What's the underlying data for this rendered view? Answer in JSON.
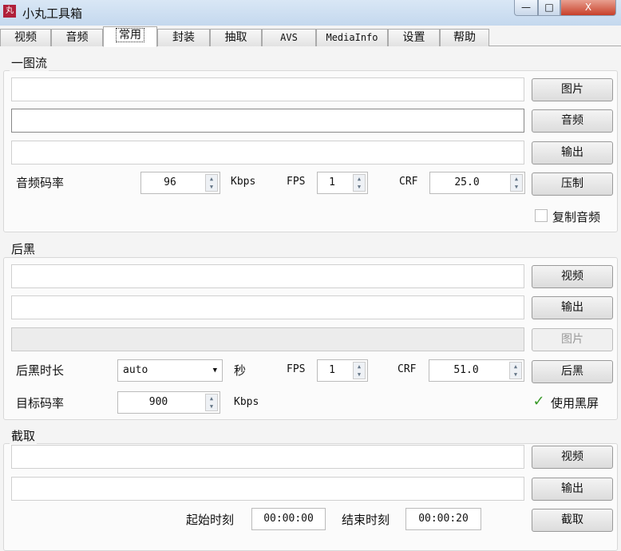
{
  "window": {
    "title": "小丸工具箱",
    "icon_text": "丸",
    "min": "—",
    "max": "□",
    "close": "X"
  },
  "tabs": [
    "视频",
    "音频",
    "常用",
    "封装",
    "抽取",
    "AVS",
    "MediaInfo",
    "设置",
    "帮助"
  ],
  "one_image": {
    "title": "一图流",
    "btn_image": "图片",
    "btn_audio": "音频",
    "btn_output": "输出",
    "btn_encode": "压制",
    "audio_bitrate_label": "音频码率",
    "audio_bitrate": "96",
    "kbps": "Kbps",
    "fps_label": "FPS",
    "fps": "1",
    "crf_label": "CRF",
    "crf": "25.0",
    "copy_audio_label": "复制音频",
    "copy_audio": false
  },
  "black_tail": {
    "title": "后黑",
    "btn_video": "视频",
    "btn_output": "输出",
    "btn_image": "图片",
    "btn_run": "后黑",
    "duration_label": "后黑时长",
    "duration": "auto",
    "sec": "秒",
    "fps_label": "FPS",
    "fps": "1",
    "crf_label": "CRF",
    "crf": "51.0",
    "bitrate_label": "目标码率",
    "bitrate": "900",
    "kbps": "Kbps",
    "use_black_label": "使用黑屏",
    "use_black": true,
    "check_mark": "✓"
  },
  "clip": {
    "title": "截取",
    "btn_video": "视频",
    "btn_output": "输出",
    "btn_run": "截取",
    "start_label": "起始时刻",
    "start": "00:00:00",
    "end_label": "结束时刻",
    "end": "00:00:20"
  },
  "spin_arrows": "▲▼"
}
